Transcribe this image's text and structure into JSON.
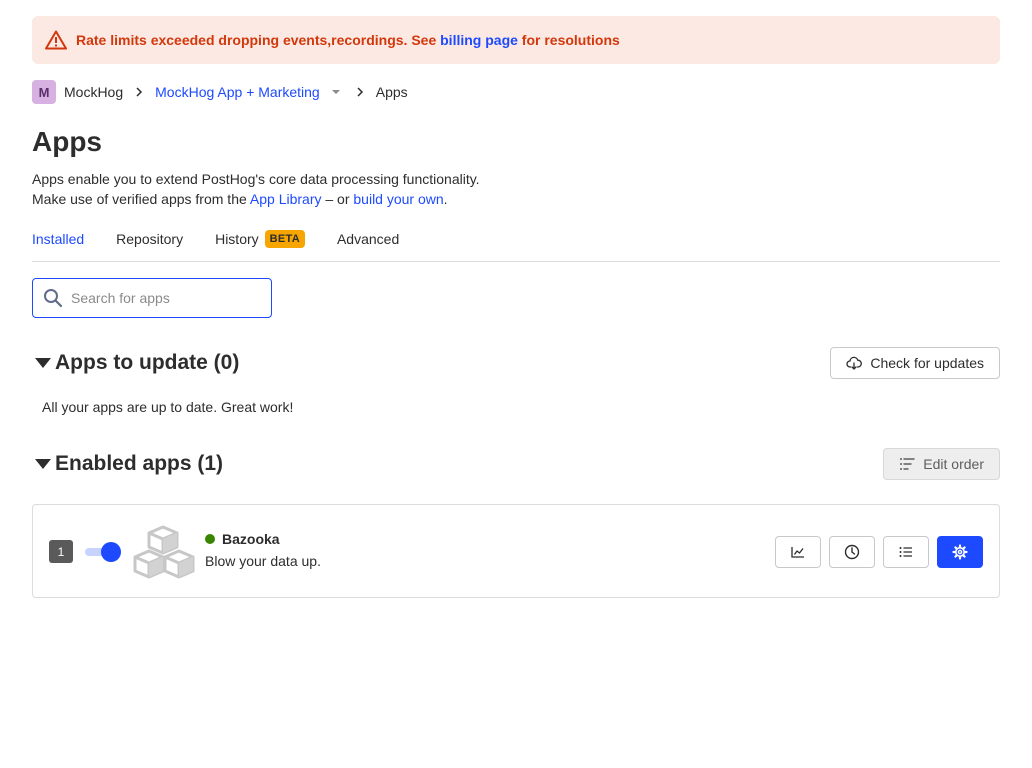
{
  "banner": {
    "text_before": "Rate limits exceeded dropping events,recordings. See ",
    "link": "billing page",
    "text_after": " for resolutions"
  },
  "breadcrumb": {
    "avatar_letter": "M",
    "org": "MockHog",
    "project": "MockHog App + Marketing",
    "current": "Apps"
  },
  "page": {
    "title": "Apps",
    "desc_line1": "Apps enable you to extend PostHog's core data processing functionality.",
    "desc_line2_prefix": "Make use of verified apps from the ",
    "desc_link1": "App Library",
    "desc_middle": " – or ",
    "desc_link2": "build your own",
    "desc_suffix": "."
  },
  "tabs": [
    {
      "label": "Installed",
      "active": true
    },
    {
      "label": "Repository"
    },
    {
      "label": "History",
      "badge": "BETA"
    },
    {
      "label": "Advanced"
    }
  ],
  "search": {
    "placeholder": "Search for apps",
    "value": ""
  },
  "updates": {
    "title": "Apps to update (0)",
    "button": "Check for updates",
    "empty_message": "All your apps are up to date. Great work!"
  },
  "enabled": {
    "title": "Enabled apps (1)",
    "button": "Edit order",
    "apps": [
      {
        "order": "1",
        "name": "Bazooka",
        "description": "Blow your data up.",
        "enabled": true,
        "status_color": "#388600"
      }
    ]
  },
  "icons": {
    "banner": "warning-triangle-icon",
    "search": "search-icon",
    "check_updates": "cloud-download-icon",
    "edit_order": "sort-list-icon",
    "metrics": "line-chart-icon",
    "history": "clock-icon",
    "logs": "list-icon",
    "settings": "gear-icon"
  },
  "colors": {
    "accent": "#1d4aff",
    "danger": "#d2380b",
    "banner_bg": "#fce9e3",
    "beta": "#f7a501",
    "success": "#388600"
  }
}
